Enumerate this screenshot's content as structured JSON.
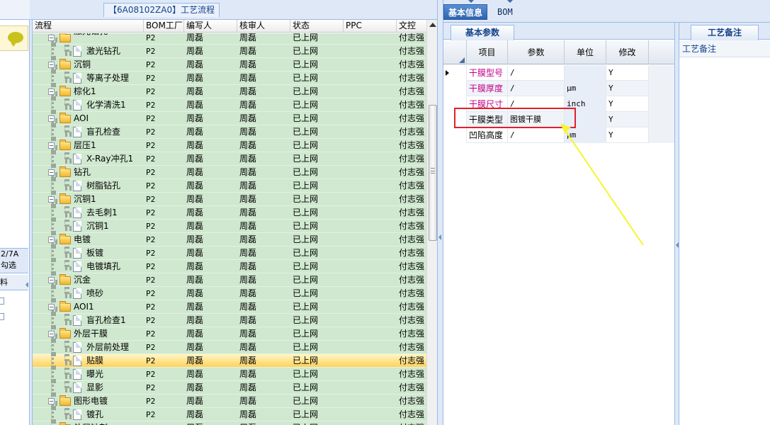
{
  "left_strip": {
    "info_line1": "2/7A",
    "info_line2": "勾选",
    "header_text": "料"
  },
  "center": {
    "title": "【6A08102ZA0】工艺流程",
    "columns": [
      "流程",
      "BOM工厂",
      "编写人",
      "核审人",
      "状态",
      "PPC",
      "文控"
    ],
    "rows": [
      {
        "level": 0,
        "type": "folder",
        "name": "激光钻孔",
        "bom": "P2",
        "writer": "周磊",
        "reviewer": "周磊",
        "status": "已上网",
        "ppc": "",
        "doc": "付志强",
        "partial": true
      },
      {
        "level": 1,
        "type": "doc",
        "name": "激光钻孔",
        "bom": "P2",
        "writer": "周磊",
        "reviewer": "周磊",
        "status": "已上网",
        "ppc": "",
        "doc": "付志强"
      },
      {
        "level": 0,
        "type": "folder",
        "name": "沉铜",
        "bom": "P2",
        "writer": "周磊",
        "reviewer": "周磊",
        "status": "已上网",
        "ppc": "",
        "doc": "付志强"
      },
      {
        "level": 1,
        "type": "doc",
        "name": "等离子处理",
        "bom": "P2",
        "writer": "周磊",
        "reviewer": "周磊",
        "status": "已上网",
        "ppc": "",
        "doc": "付志强"
      },
      {
        "level": 0,
        "type": "folder",
        "name": "棕化1",
        "bom": "P2",
        "writer": "周磊",
        "reviewer": "周磊",
        "status": "已上网",
        "ppc": "",
        "doc": "付志强"
      },
      {
        "level": 1,
        "type": "doc",
        "name": "化学清洗1",
        "bom": "P2",
        "writer": "周磊",
        "reviewer": "周磊",
        "status": "已上网",
        "ppc": "",
        "doc": "付志强"
      },
      {
        "level": 0,
        "type": "folder",
        "name": "AOI",
        "bom": "P2",
        "writer": "周磊",
        "reviewer": "周磊",
        "status": "已上网",
        "ppc": "",
        "doc": "付志强"
      },
      {
        "level": 1,
        "type": "doc",
        "name": "盲孔检查",
        "bom": "P2",
        "writer": "周磊",
        "reviewer": "周磊",
        "status": "已上网",
        "ppc": "",
        "doc": "付志强"
      },
      {
        "level": 0,
        "type": "folder",
        "name": "层压1",
        "bom": "P2",
        "writer": "周磊",
        "reviewer": "周磊",
        "status": "已上网",
        "ppc": "",
        "doc": "付志强"
      },
      {
        "level": 1,
        "type": "doc",
        "name": "X-Ray冲孔1",
        "bom": "P2",
        "writer": "周磊",
        "reviewer": "周磊",
        "status": "已上网",
        "ppc": "",
        "doc": "付志强"
      },
      {
        "level": 0,
        "type": "folder",
        "name": "钻孔",
        "bom": "P2",
        "writer": "周磊",
        "reviewer": "周磊",
        "status": "已上网",
        "ppc": "",
        "doc": "付志强"
      },
      {
        "level": 1,
        "type": "doc",
        "name": "树脂钻孔",
        "bom": "P2",
        "writer": "周磊",
        "reviewer": "周磊",
        "status": "已上网",
        "ppc": "",
        "doc": "付志强"
      },
      {
        "level": 0,
        "type": "folder",
        "name": "沉铜1",
        "bom": "P2",
        "writer": "周磊",
        "reviewer": "周磊",
        "status": "已上网",
        "ppc": "",
        "doc": "付志强"
      },
      {
        "level": 1,
        "type": "doc",
        "name": "去毛刺1",
        "bom": "P2",
        "writer": "周磊",
        "reviewer": "周磊",
        "status": "已上网",
        "ppc": "",
        "doc": "付志强"
      },
      {
        "level": 1,
        "type": "doc",
        "name": "沉铜1",
        "bom": "P2",
        "writer": "周磊",
        "reviewer": "周磊",
        "status": "已上网",
        "ppc": "",
        "doc": "付志强"
      },
      {
        "level": 0,
        "type": "folder",
        "name": "电镀",
        "bom": "P2",
        "writer": "周磊",
        "reviewer": "周磊",
        "status": "已上网",
        "ppc": "",
        "doc": "付志强"
      },
      {
        "level": 1,
        "type": "doc",
        "name": "板镀",
        "bom": "P2",
        "writer": "周磊",
        "reviewer": "周磊",
        "status": "已上网",
        "ppc": "",
        "doc": "付志强"
      },
      {
        "level": 1,
        "type": "doc",
        "name": "电镀填孔",
        "bom": "P2",
        "writer": "周磊",
        "reviewer": "周磊",
        "status": "已上网",
        "ppc": "",
        "doc": "付志强"
      },
      {
        "level": 0,
        "type": "folder",
        "name": "沉金",
        "bom": "P2",
        "writer": "周磊",
        "reviewer": "周磊",
        "status": "已上网",
        "ppc": "",
        "doc": "付志强"
      },
      {
        "level": 1,
        "type": "doc",
        "name": "喷砂",
        "bom": "P2",
        "writer": "周磊",
        "reviewer": "周磊",
        "status": "已上网",
        "ppc": "",
        "doc": "付志强"
      },
      {
        "level": 0,
        "type": "folder",
        "name": "AOI1",
        "bom": "P2",
        "writer": "周磊",
        "reviewer": "周磊",
        "status": "已上网",
        "ppc": "",
        "doc": "付志强"
      },
      {
        "level": 1,
        "type": "doc",
        "name": "盲孔检查1",
        "bom": "P2",
        "writer": "周磊",
        "reviewer": "周磊",
        "status": "已上网",
        "ppc": "",
        "doc": "付志强"
      },
      {
        "level": 0,
        "type": "folder",
        "name": "外层干膜",
        "bom": "P2",
        "writer": "周磊",
        "reviewer": "周磊",
        "status": "已上网",
        "ppc": "",
        "doc": "付志强"
      },
      {
        "level": 1,
        "type": "doc",
        "name": "外层前处理",
        "bom": "P2",
        "writer": "周磊",
        "reviewer": "周磊",
        "status": "已上网",
        "ppc": "",
        "doc": "付志强"
      },
      {
        "level": 1,
        "type": "doc",
        "name": "贴膜",
        "bom": "P2",
        "writer": "周磊",
        "reviewer": "周磊",
        "status": "已上网",
        "ppc": "",
        "doc": "付志强",
        "selected": true
      },
      {
        "level": 1,
        "type": "doc",
        "name": "曝光",
        "bom": "P2",
        "writer": "周磊",
        "reviewer": "周磊",
        "status": "已上网",
        "ppc": "",
        "doc": "付志强"
      },
      {
        "level": 1,
        "type": "doc",
        "name": "显影",
        "bom": "P2",
        "writer": "周磊",
        "reviewer": "周磊",
        "status": "已上网",
        "ppc": "",
        "doc": "付志强"
      },
      {
        "level": 0,
        "type": "folder",
        "name": "图形电镀",
        "bom": "P2",
        "writer": "周磊",
        "reviewer": "周磊",
        "status": "已上网",
        "ppc": "",
        "doc": "付志强"
      },
      {
        "level": 1,
        "type": "doc",
        "name": "镀孔",
        "bom": "P2",
        "writer": "周磊",
        "reviewer": "周磊",
        "status": "已上网",
        "ppc": "",
        "doc": "付志强"
      },
      {
        "level": 0,
        "type": "folder",
        "name": "外层蚀刻",
        "bom": "P2",
        "writer": "周磊",
        "reviewer": "周磊",
        "status": "已上网",
        "ppc": "",
        "doc": "付志强"
      }
    ]
  },
  "right": {
    "tabs": [
      {
        "label": "基本信息",
        "active": true
      },
      {
        "label": "BOM",
        "active": false
      }
    ],
    "params_tab": "基本参数",
    "params_columns": [
      "项目",
      "参数",
      "单位",
      "修改"
    ],
    "params_rows": [
      {
        "item": "干膜型号",
        "param": "/",
        "unit": "",
        "modify": "Y",
        "current": true,
        "highlight_item": true
      },
      {
        "item": "干膜厚度",
        "param": "/",
        "unit": "μm",
        "modify": "Y",
        "current": false,
        "highlight_item": true
      },
      {
        "item": "干膜尺寸",
        "param": "/",
        "unit": "inch",
        "modify": "Y",
        "current": false,
        "highlight_item": true
      },
      {
        "item": "干膜类型",
        "param": "图镀干膜",
        "unit": "",
        "modify": "Y",
        "current": false,
        "highlight_item": false
      },
      {
        "item": "凹陷高度",
        "param": "/",
        "unit": "μm",
        "modify": "Y",
        "current": false,
        "highlight_item": false
      }
    ],
    "notes_tab": "工艺备注",
    "notes_label": "工艺备注"
  },
  "colors": {
    "row_green": "#cfe8cf",
    "selected_row": "#ffd25a",
    "panel_border": "#99bbe8",
    "item_magenta": "#c1008a",
    "annotation_red": "#e0202a",
    "arrow_yellow": "#f5f532"
  }
}
